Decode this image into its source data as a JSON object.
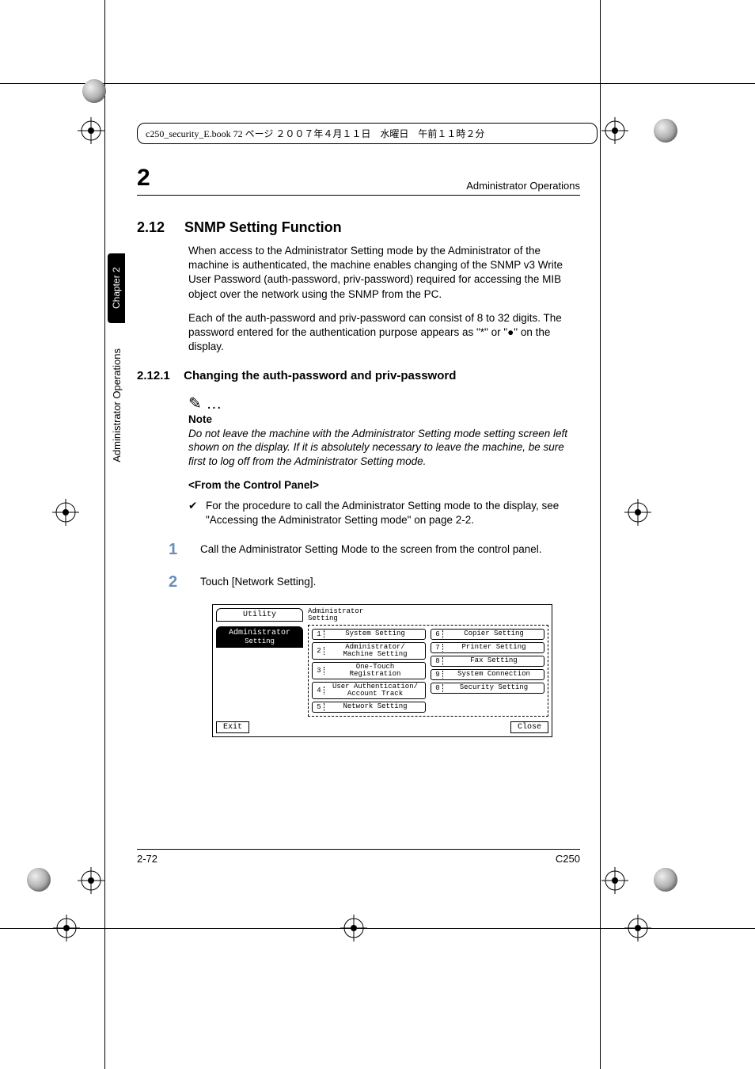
{
  "header_strip": "c250_security_E.book  72 ページ  ２００７年４月１１日　水曜日　午前１１時２分",
  "running_head": {
    "chapter_number": "2",
    "title": "Administrator Operations"
  },
  "side": {
    "tab": "Chapter 2",
    "text": "Administrator Operations"
  },
  "section": {
    "number": "2.12",
    "title": "SNMP Setting Function",
    "para1": "When access to the Administrator Setting mode by the Administrator of the machine is authenticated, the machine enables changing of the SNMP v3 Write User Password (auth-password, priv-password) required for accessing the MIB object over the network using the SNMP from the PC.",
    "para2": "Each of the auth-password and priv-password can consist of 8 to 32 digits. The password entered for the authentication purpose appears as \"*\" or \"●\" on the display."
  },
  "subsection": {
    "number": "2.12.1",
    "title": "Changing the auth-password and priv-password"
  },
  "note": {
    "icon": "✎ …",
    "label": "Note",
    "body": "Do not leave the machine with the Administrator Setting mode setting screen left shown on the display. If it is absolutely necessary to leave the machine, be sure first to log off from the Administrator Setting mode."
  },
  "control_panel_heading": "<From the Control Panel>",
  "bullet": {
    "mark": "✔",
    "text": "For the procedure to call the Administrator Setting mode to the display, see \"Accessing the Administrator Setting mode\" on page 2-2."
  },
  "steps": [
    {
      "n": "1",
      "text": "Call the Administrator Setting Mode to the screen from the control panel."
    },
    {
      "n": "2",
      "text": "Touch [Network Setting]."
    }
  ],
  "screenshot": {
    "left_tabs": [
      {
        "label": "Utility",
        "selected": false
      },
      {
        "label": "Administrator",
        "label2": "Setting",
        "selected": true
      }
    ],
    "breadcrumb": "Administrator\nSetting",
    "left_col": [
      {
        "n": "1",
        "label": "System Setting"
      },
      {
        "n": "2",
        "label": "Administrator/\nMachine Setting"
      },
      {
        "n": "3",
        "label": "One-Touch\nRegistration"
      },
      {
        "n": "4",
        "label": "User Authentication/\nAccount Track"
      },
      {
        "n": "5",
        "label": "Network Setting"
      }
    ],
    "right_col": [
      {
        "n": "6",
        "label": "Copier Setting"
      },
      {
        "n": "7",
        "label": "Printer Setting"
      },
      {
        "n": "8",
        "label": "Fax Setting"
      },
      {
        "n": "9",
        "label": "System Connection"
      },
      {
        "n": "0",
        "label": "Security Setting"
      }
    ],
    "footer": {
      "exit": "Exit",
      "close": "Close"
    }
  },
  "footer": {
    "left": "2-72",
    "right": "C250"
  }
}
